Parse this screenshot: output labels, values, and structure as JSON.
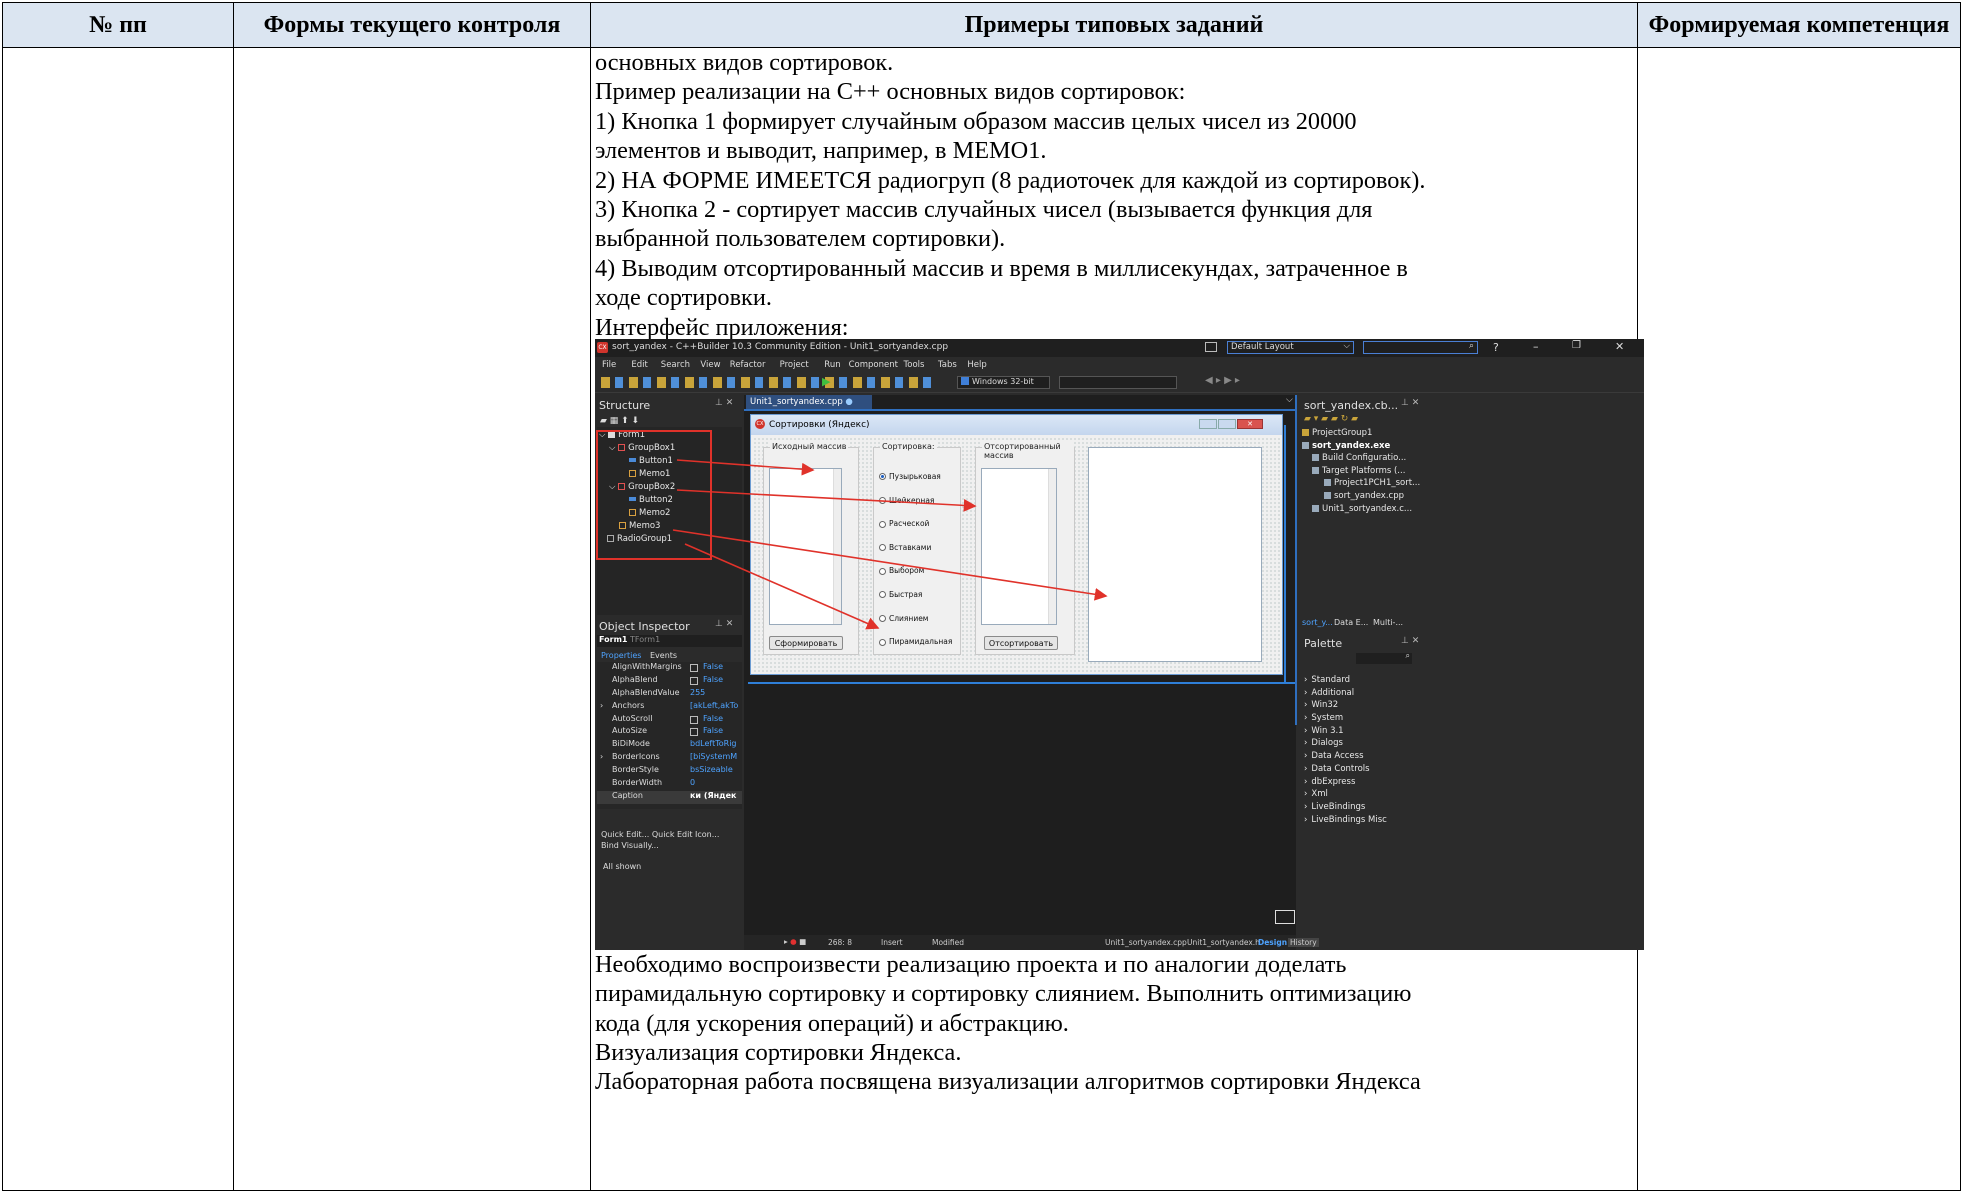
{
  "table": {
    "headers": {
      "num": "№ пп",
      "forms": "Формы текущего контроля",
      "examples": "Примеры типовых заданий",
      "competence": "Формируемая компетенция"
    },
    "lines_top": [
      "основных видов сортировок.",
      "Пример реализации на С++ основных видов сортировок:",
      "1)   Кнопка 1  формирует случайным образом массив целых чисел из 20000",
      "элементов и выводит, например, в МЕМО1.",
      "2)   НА ФОРМЕ ИМЕЕТСЯ радиогруп (8 радиоточек для каждой из сортировок).",
      "3)   Кнопка 2 - сортирует массив случайных чисел (вызывается функция для",
      "выбранной пользователем сортировки).",
      "4)   Выводим отсортированный массив и время в миллисекундах, затраченное в",
      "ходе сортировки.",
      "Интерфейс приложения:"
    ],
    "lines_bottom": [
      "Необходимо воспроизвести реализацию проекта и по аналогии доделать",
      "пирамидальную сортировку и сортировку слиянием. Выполнить оптимизацию",
      "кода (для ускорения операций) и абстракцию.",
      "Визуализация сортировки Яндекса.",
      "Лабораторная работа посвящена визуализации алгоритмов сортировки Яндекса"
    ]
  },
  "ide": {
    "title": "sort_yandex - C++Builder 10.3 Community Edition - Unit1_sortyandex.cpp",
    "layout": "Default Layout",
    "menu": [
      "File",
      "Edit",
      "Search",
      "View",
      "Refactor",
      "Project",
      "Run",
      "Component",
      "Tools",
      "Tabs",
      "Help"
    ],
    "platform": "Windows 32-bit",
    "structure_title": "Structure",
    "structure_items": [
      "Form1",
      "GroupBox1",
      "Button1",
      "Memo1",
      "GroupBox2",
      "Button2",
      "Memo2",
      "Memo3",
      "RadioGroup1"
    ],
    "editor_tab": "Unit1_sortyandex.cpp",
    "form": {
      "caption": "Сортировки (Яндекс)",
      "group1": "Исходный массив",
      "group2": "Сортировка:",
      "group3": "Отсортированный массив",
      "btn1": "Сформировать",
      "btn2": "Отсортировать",
      "radios": [
        "Пузырьковая",
        "Шейкерная",
        "Расческой",
        "Вставками",
        "Выбором",
        "Быстрая",
        "Слиянием",
        "Пирамидальная"
      ]
    },
    "inspector": {
      "title": "Object Inspector",
      "object": "Form1",
      "object_type": "TForm1",
      "tab_props": "Properties",
      "tab_events": "Events",
      "rows": [
        {
          "name": "AlignWithMargins",
          "value": "False"
        },
        {
          "name": "AlphaBlend",
          "value": "False"
        },
        {
          "name": "AlphaBlendValue",
          "value": "255"
        },
        {
          "name": "Anchors",
          "value": "[akLeft,akTo"
        },
        {
          "name": "AutoScroll",
          "value": "False"
        },
        {
          "name": "AutoSize",
          "value": "False"
        },
        {
          "name": "BiDiMode",
          "value": "bdLeftToRig"
        },
        {
          "name": "BorderIcons",
          "value": "[biSystemM"
        },
        {
          "name": "BorderStyle",
          "value": "bsSizeable"
        },
        {
          "name": "BorderWidth",
          "value": "0"
        },
        {
          "name": "Caption",
          "value": "ки (Яндек"
        }
      ],
      "quick": "Quick Edit...  Quick Edit Icon...",
      "bind": "Bind Visually...",
      "all_shown": "All shown"
    },
    "project": {
      "title": "sort_yandex.cb...",
      "items": [
        "ProjectGroup1",
        "sort_yandex.exe",
        "Build Configuratio...",
        "Target Platforms (...",
        "Project1PCH1_sort...",
        "sort_yandex.cpp",
        "Unit1_sortyandex.c..."
      ],
      "tabs": [
        "sort_y...",
        "Data E...",
        "Multi-..."
      ]
    },
    "palette": {
      "title": "Palette",
      "items": [
        "Standard",
        "Additional",
        "Win32",
        "System",
        "Win 3.1",
        "Dialogs",
        "Data Access",
        "Data Controls",
        "dbExpress",
        "Xml",
        "LiveBindings",
        "LiveBindings Misc"
      ]
    },
    "status": {
      "pos": "268:  8",
      "mode": "Insert",
      "modified": "Modified",
      "file_cpp": "Unit1_sortyandex.cpp",
      "file_h": "Unit1_sortyandex.h",
      "design": "Design",
      "history": "History"
    }
  }
}
